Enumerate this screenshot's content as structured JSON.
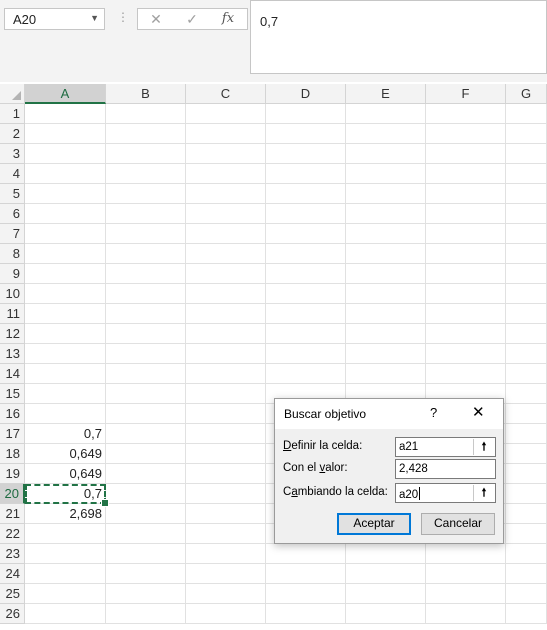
{
  "formula_bar": {
    "name_box": "A20",
    "formula": "0,7",
    "icons": [
      "chevron-down-icon",
      "more-icon",
      "cancel-icon",
      "enter-icon",
      "function-icon"
    ],
    "fx_label": "fx",
    "cancel_glyph": "✕",
    "enter_glyph": "✓"
  },
  "sheet": {
    "columns": [
      "A",
      "B",
      "C",
      "D",
      "E",
      "F",
      "G"
    ],
    "active_column": "A",
    "active_row": "20",
    "rows": [
      {
        "n": "1",
        "a": ""
      },
      {
        "n": "2",
        "a": ""
      },
      {
        "n": "3",
        "a": ""
      },
      {
        "n": "4",
        "a": ""
      },
      {
        "n": "5",
        "a": ""
      },
      {
        "n": "6",
        "a": ""
      },
      {
        "n": "7",
        "a": ""
      },
      {
        "n": "8",
        "a": ""
      },
      {
        "n": "9",
        "a": ""
      },
      {
        "n": "10",
        "a": ""
      },
      {
        "n": "11",
        "a": ""
      },
      {
        "n": "12",
        "a": ""
      },
      {
        "n": "13",
        "a": ""
      },
      {
        "n": "14",
        "a": ""
      },
      {
        "n": "15",
        "a": ""
      },
      {
        "n": "16",
        "a": ""
      },
      {
        "n": "17",
        "a": "0,7"
      },
      {
        "n": "18",
        "a": "0,649"
      },
      {
        "n": "19",
        "a": "0,649"
      },
      {
        "n": "20",
        "a": "0,7"
      },
      {
        "n": "21",
        "a": "2,698"
      },
      {
        "n": "22",
        "a": ""
      },
      {
        "n": "23",
        "a": ""
      },
      {
        "n": "24",
        "a": ""
      },
      {
        "n": "25",
        "a": ""
      },
      {
        "n": "26",
        "a": ""
      }
    ]
  },
  "dialog": {
    "title": "Buscar objetivo",
    "help": "?",
    "close": "✕",
    "fields": [
      {
        "label_ul": "D",
        "label_rest": "efinir la celda:",
        "label_pre": "",
        "value": "a21",
        "has_ref_button": true
      },
      {
        "label_ul": "v",
        "label_pre": "Con el ",
        "label_rest": "alor:",
        "value": "2,428",
        "has_ref_button": false
      },
      {
        "label_ul": "a",
        "label_pre": "C",
        "label_rest": "mbiando la celda:",
        "value": "a20",
        "has_ref_button": true
      }
    ],
    "ref_glyph": "🠕",
    "ok_label": "Aceptar",
    "cancel_label": "Cancelar"
  }
}
